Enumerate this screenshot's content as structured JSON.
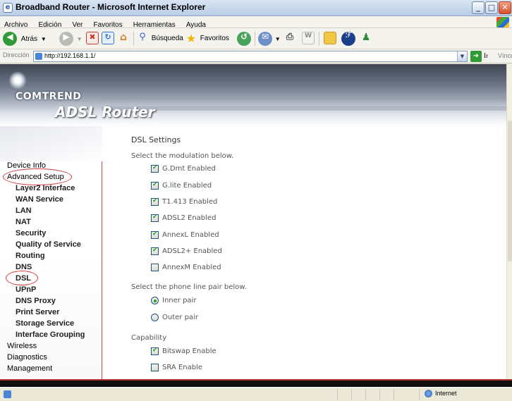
{
  "window": {
    "title": "Broadband Router - Microsoft Internet Explorer",
    "controls": [
      "_",
      "□",
      "✕"
    ]
  },
  "menubar": [
    "Archivo",
    "Edición",
    "Ver",
    "Favoritos",
    "Herramientas",
    "Ayuda"
  ],
  "toolbar": {
    "back_label": "Atrás",
    "search_label": "Búsqueda",
    "favorites_label": "Favoritos"
  },
  "address": {
    "label": "Dirección",
    "url": "http://192.168.1.1/",
    "go_label": "Ir",
    "links_label": "Vínculos"
  },
  "banner": {
    "brand": "COMTREND",
    "product": "ADSL Router"
  },
  "nav": {
    "top_items": [
      "Device Info",
      "Advanced Setup"
    ],
    "sub_items": [
      "Layer2 Interface",
      "WAN Service",
      "LAN",
      "NAT",
      "Security",
      "Quality of Service",
      "Routing",
      "DNS",
      "DSL",
      "UPnP",
      "DNS Proxy",
      "Print Server",
      "Storage Service",
      "Interface Grouping"
    ],
    "bottom_items": [
      "Wireless",
      "Diagnostics",
      "Management"
    ],
    "circled": [
      "Advanced Setup",
      "DSL"
    ]
  },
  "main": {
    "title": "DSL Settings",
    "modulation_prompt": "Select the modulation below.",
    "modulation": [
      {
        "label": "G.Dmt Enabled",
        "checked": true
      },
      {
        "label": "G.lite Enabled",
        "checked": true
      },
      {
        "label": "T1.413 Enabled",
        "checked": true
      },
      {
        "label": "ADSL2 Enabled",
        "checked": true
      },
      {
        "label": "AnnexL Enabled",
        "checked": true
      },
      {
        "label": "ADSL2+ Enabled",
        "checked": true
      },
      {
        "label": "AnnexM Enabled",
        "checked": false
      }
    ],
    "pair_prompt": "Select the phone line pair below.",
    "pairs": [
      {
        "label": "Inner pair",
        "selected": true
      },
      {
        "label": "Outer pair",
        "selected": false
      }
    ],
    "capability_heading": "Capability",
    "capability": [
      {
        "label": "Bitswap Enable",
        "checked": true
      },
      {
        "label": "SRA Enable",
        "checked": false
      }
    ]
  },
  "status": {
    "zone": "Internet"
  },
  "colors": {
    "accent_red": "#d2383c",
    "checkmark_green": "#21a121",
    "title_bar_blue": "#b9cde6"
  }
}
